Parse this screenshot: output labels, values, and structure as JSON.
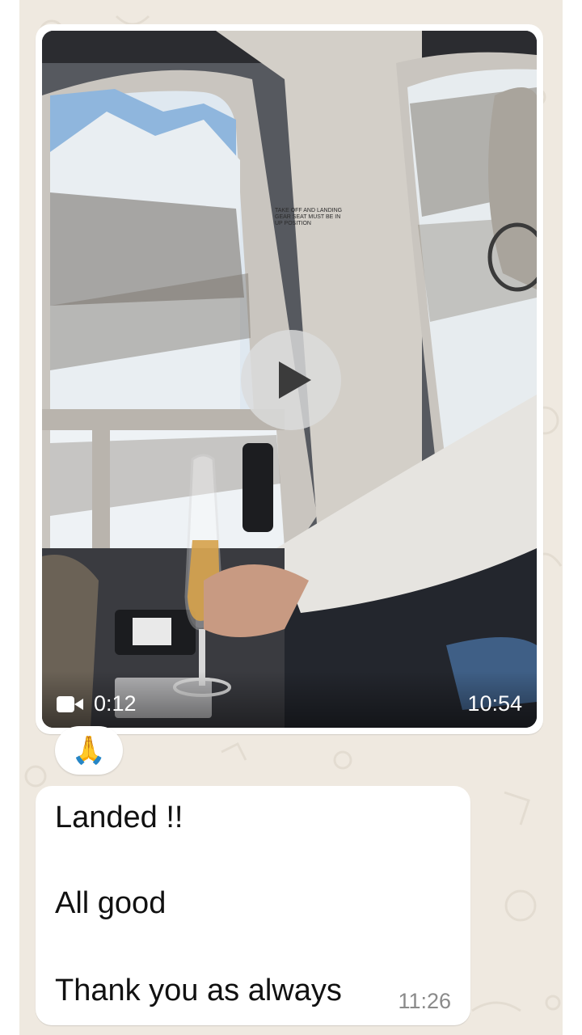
{
  "video_message": {
    "duration": "0:12",
    "timestamp": "10:54",
    "icons": {
      "media_type": "video-camera-icon",
      "play": "play-icon"
    },
    "thumbnail_sign": "TAKE OFF AND LANDING GEAR SEAT MUST BE IN UP POSITION"
  },
  "reaction": {
    "emoji": "🙏"
  },
  "text_message": {
    "lines": [
      "Landed !!",
      "All good",
      "Thank you as always"
    ],
    "timestamp": "11:26"
  },
  "colors": {
    "chat_background": "#efe9e0",
    "bubble_background": "#ffffff",
    "timestamp_gray": "#8a8a8a"
  }
}
